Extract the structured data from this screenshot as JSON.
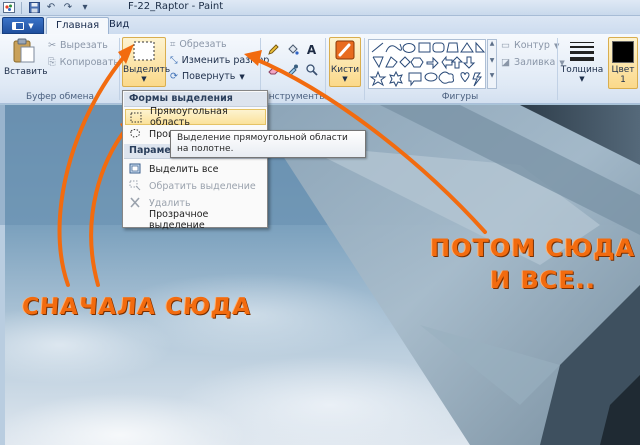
{
  "window": {
    "title": "F-22_Raptor - Paint"
  },
  "tabs": [
    {
      "label": "Главная",
      "active": true
    },
    {
      "label": "Вид",
      "active": false
    }
  ],
  "ribbon": {
    "clipboard": {
      "group_label": "Буфер обмена",
      "paste_label": "Вставить",
      "cut_label": "Вырезать",
      "copy_label": "Копировать"
    },
    "image": {
      "select_label": "Выделить",
      "crop_label": "Обрезать",
      "resize_label": "Изменить размер",
      "rotate_label": "Повернуть"
    },
    "tools": {
      "group_label": "Инструменты"
    },
    "brushes": {
      "label": "Кисти"
    },
    "shapes": {
      "group_label": "Фигуры",
      "outline_label": "Контур",
      "fill_label": "Заливка"
    },
    "size": {
      "label": "Толщина"
    },
    "colors": {
      "color1_label": "Цвет",
      "color1_index": "1"
    }
  },
  "select_menu": {
    "shapes_header": "Формы выделения",
    "rect_item": "Прямоугольная область",
    "free_item": "Прои",
    "options_header": "Параметр",
    "select_all": "Выделить все",
    "invert": "Обратить выделение",
    "delete": "Удалить",
    "transparent": "Прозрачное выделение"
  },
  "tooltip": {
    "text": "Выделение прямоугольной области на полотне."
  },
  "annotations": {
    "first": "СНАЧАЛА СЮДА",
    "second_line1": "ПОТОМ СЮДА",
    "second_line2": "И ВСЕ.."
  },
  "colors": {
    "accent_orange": "#f26b0f",
    "file_button": "#2a62b8",
    "menu_hover": "#fbe29b"
  }
}
